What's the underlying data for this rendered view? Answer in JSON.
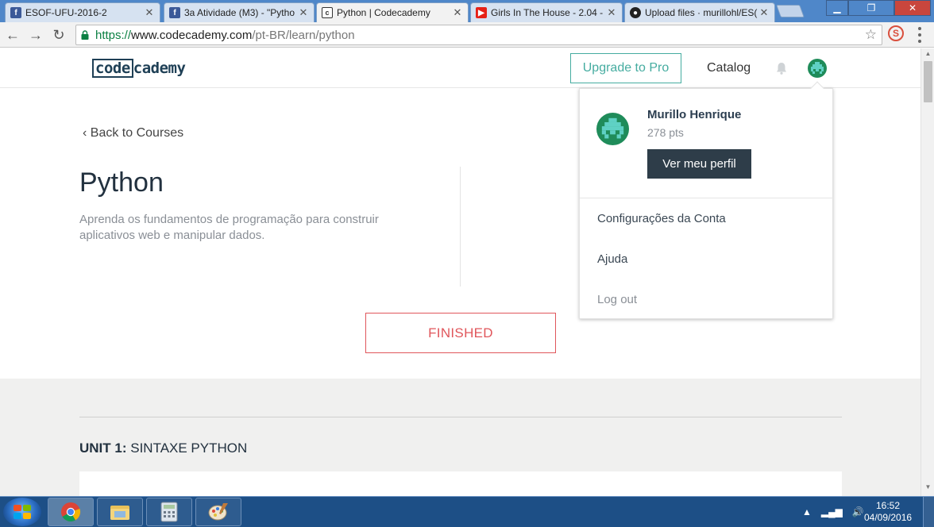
{
  "browser": {
    "tabs": [
      {
        "title": "ESOF-UFU-2016-2",
        "favicon": "facebook-icon"
      },
      {
        "title": "3a Atividade (M3) - \"Pytho",
        "favicon": "facebook-icon"
      },
      {
        "title": "Python | Codecademy",
        "favicon": "codecademy-icon",
        "active": true
      },
      {
        "title": "Girls In The House - 2.04 -",
        "favicon": "youtube-icon"
      },
      {
        "title": "Upload files · murillohl/ES(",
        "favicon": "github-icon"
      }
    ],
    "url": {
      "scheme": "https://",
      "host": "www.codecademy.com",
      "path": "/pt-BR/learn/python"
    }
  },
  "header": {
    "logo_box": "code",
    "logo_rest": "cademy",
    "upgrade_label": "Upgrade to Pro",
    "catalog_label": "Catalog"
  },
  "course": {
    "back_label": "Back to Courses",
    "title": "Python",
    "description": "Aprenda os fundamentos de programação para construir aplicativos web e manipular dados.",
    "status_label": "FINISHED"
  },
  "units": [
    {
      "label": "UNIT 1:",
      "title": "SINTAXE PYTHON"
    }
  ],
  "profile_menu": {
    "name": "Murillo Henrique",
    "points": "278 pts",
    "profile_button": "Ver meu perfil",
    "items": [
      "Configurações da Conta",
      "Ajuda",
      "Log out"
    ]
  },
  "taskbar": {
    "time": "16:52",
    "date": "04/09/2016"
  },
  "colors": {
    "accent_teal": "#45aca0",
    "finished_red": "#e0565b",
    "dark_button": "#2e3d49",
    "chrome_frame": "#4f87c9"
  }
}
